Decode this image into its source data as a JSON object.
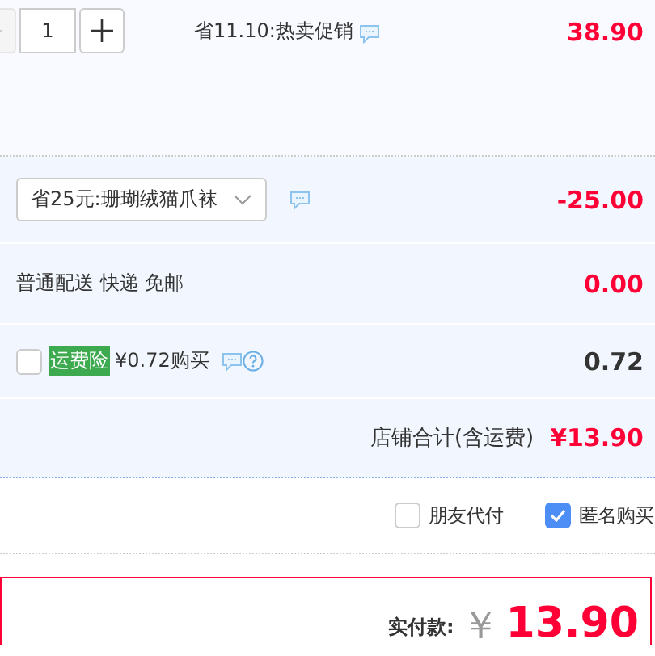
{
  "item": {
    "quantity": "1",
    "promo": "省11.10:热卖促销",
    "price": "38.90"
  },
  "coupon": {
    "value": "省25元:珊瑚绒猫爪袜",
    "amount": "-25.00"
  },
  "delivery": {
    "label": "普通配送 快递 免邮",
    "amount": "0.00"
  },
  "insurance": {
    "checked": false,
    "tag": "运费险",
    "label": "¥0.72购买",
    "amount": "0.72"
  },
  "shop_total": {
    "label": "店铺合计(含运费)",
    "amount": "¥13.90"
  },
  "options": [
    {
      "label": "朋友代付",
      "checked": false
    },
    {
      "label": "匿名购买",
      "checked": true
    }
  ],
  "payment": {
    "label": "实付款:",
    "currency": "￥",
    "amount": "13.90"
  }
}
